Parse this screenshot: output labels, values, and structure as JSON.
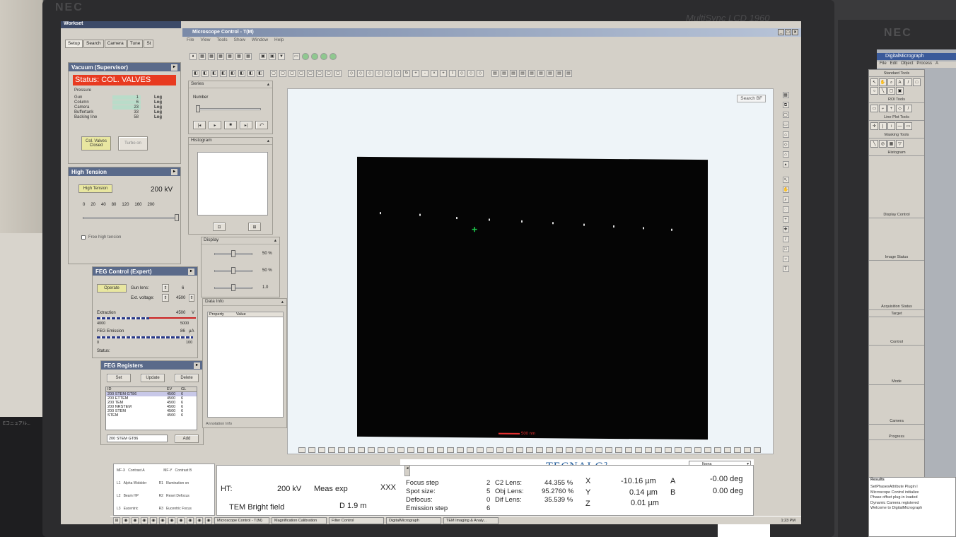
{
  "bezel": {
    "brand": "NEC",
    "model": "MultiSync LCD 1960",
    "brand2": "NEC"
  },
  "left_box_label": "Eコニュアル...",
  "workset": {
    "title": "Workset",
    "tabs": [
      "Setup",
      "Search",
      "Camera",
      "Tune",
      "St"
    ],
    "vacuum": {
      "header": "Vacuum (Supervisor)",
      "status": "Status:  COL. VALVES",
      "pressure_label": "Pressure",
      "rows": [
        {
          "name": "Gun",
          "value": "1",
          "unit": "Log"
        },
        {
          "name": "Column",
          "value": "6",
          "unit": "Log"
        },
        {
          "name": "Camera",
          "value": "23",
          "unit": "Log"
        },
        {
          "name": "Buffertank",
          "value": "33",
          "unit": "Log"
        },
        {
          "name": "Backing line",
          "value": "58",
          "unit": "Log"
        }
      ],
      "col_valves_btn": "Col. Valves Closed",
      "turbo_btn": "Turbo on"
    },
    "high_tension": {
      "header": "High Tension",
      "button": "High Tension",
      "value": "200 kV",
      "ticks": [
        "0",
        "20",
        "40",
        "80",
        "120",
        "160",
        "200"
      ],
      "free_label": "Free high tension"
    },
    "feg_control": {
      "header": "FEG Control (Expert)",
      "operate": "Operate",
      "gun_lens_label": "Gun lens:",
      "gun_lens_value": "6",
      "ext_voltage_label": "Ext. voltage:",
      "ext_voltage_value": "4500",
      "extraction_label": "Extraction",
      "extraction_value": "4500",
      "extraction_unit": "V",
      "extraction_min": "4000",
      "extraction_max": "5000",
      "emission_label": "FEG Emission",
      "emission_value": "86",
      "emission_unit": "µA",
      "emission_min": "0",
      "emission_max": "100",
      "status_label": "Status:"
    },
    "feg_registers": {
      "header": "FEG Registers",
      "set": "Set",
      "update": "Update",
      "delete": "Delete",
      "columns": [
        "ID",
        "EV",
        "GL"
      ],
      "rows": [
        [
          "200 STEM GT86",
          "4500",
          "6"
        ],
        [
          "200 ETTEM",
          "4500",
          "6"
        ],
        [
          "200 TEM",
          "4500",
          "6"
        ],
        [
          "200 NRSTEM",
          "4500",
          "6"
        ],
        [
          "200 STEM",
          "4500",
          "6"
        ],
        [
          "STEM",
          "4500",
          "6"
        ]
      ],
      "input_value": "200 STEM GT86",
      "add": "Add"
    }
  },
  "mc": {
    "title": "Microscope Control - T(M)",
    "menu": [
      "File",
      "View",
      "Tools",
      "Show",
      "Window",
      "Help"
    ],
    "series": {
      "header": "Series",
      "number_label": "Number"
    },
    "histogram": {
      "header": "Histogram"
    },
    "display": {
      "header": "Display",
      "v1": "50 %",
      "v2": "50 %",
      "v3": "1.0"
    },
    "data_info": {
      "header": "Data Info",
      "col1": "Property",
      "col2": "Value",
      "footer": "Annotation Info"
    },
    "search_bf": "Search BF",
    "scale_label": "500 nm"
  },
  "bottom": {
    "tecnai": "TECNAI G²",
    "dropdown": "Ikona",
    "ht_label": "HT:",
    "ht_value": "200 kV",
    "mode": "Meas exp",
    "xxx": "XXX",
    "tem_mode": "TEM Bright field",
    "d_value": "D 1.9 m",
    "focus_step_label": "Focus step",
    "focus_step": "2",
    "spot_size_label": "Spot size:",
    "spot_size": "5",
    "defocus_label": "Defocus:",
    "defocus": "0",
    "emission_step_label": "Emission step",
    "emission_step": "6",
    "c2_label": "C2 Lens:",
    "c2": "44.355 %",
    "obj_label": "Obj Lens:",
    "obj": "95.2760 %",
    "dif_label": "Dif Lens:",
    "dif": "35.539 %",
    "x_label": "X",
    "x": "-10.16 µm",
    "a_label": "A",
    "a": "-0.00 deg",
    "y_label": "Y",
    "y": "0.14 µm",
    "b_label": "B",
    "b": "0.00 deg",
    "z_label": "Z",
    "z": "0.01 µm",
    "left_labels": [
      [
        "MF-X",
        "Contrast A",
        "MF-Y",
        "Contrast B"
      ],
      [
        "L1",
        "Alpha Wobbler",
        "R1",
        "Illumination on"
      ],
      [
        "L2",
        "Beam HP",
        "R2",
        "Reset Defocus"
      ],
      [
        "L3",
        "Eucentric",
        "R3",
        "Eucentric Focus"
      ]
    ]
  },
  "taskbar": [
    "Microscope Control - T(M)",
    "Magnification Calibration",
    "Filter Control",
    "DigitalMicrograph",
    "TEM Imaging & Analy..."
  ],
  "taskbar_time": "1:23 PM",
  "dm": {
    "title": "DigitalMicrograph",
    "menu": [
      "File",
      "Edit",
      "Object",
      "Process",
      "A"
    ],
    "sections": [
      "Standard Tools",
      "ROI Tools",
      "Line Plot Tools",
      "Masking Tools",
      "Histogram",
      "Display Control",
      "Image Status",
      "Acquisition Status",
      "Target",
      "Control",
      "Mode",
      "Camera",
      "Progress"
    ],
    "output_title": "Results",
    "output_lines": [
      "SetPhasesAttribute Plugin l",
      "Microscope Control initialize",
      "Phase offset plug-in loaded",
      "Dynamic Camera registered",
      "Welcome to DigitalMicrograph"
    ]
  }
}
